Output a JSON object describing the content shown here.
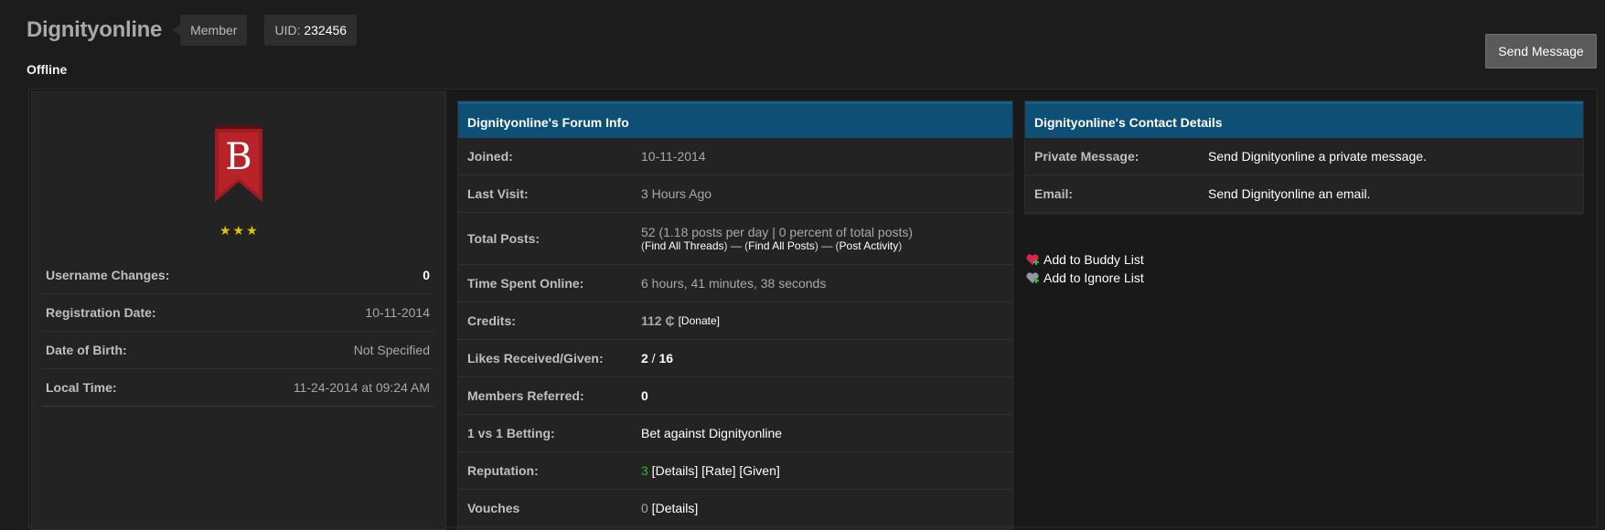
{
  "profile": {
    "username": "Dignityonline",
    "group": "Member",
    "uid_label": "UID:",
    "uid": "232456",
    "status": "Offline",
    "send_message_label": "Send Message",
    "avatar_letter": "B",
    "stars": "★★★"
  },
  "left_table": [
    {
      "label": "Username Changes:",
      "value": "0"
    },
    {
      "label": "Registration Date:",
      "value": "10-11-2014"
    },
    {
      "label": "Date of Birth:",
      "value": "Not Specified"
    },
    {
      "label": "Local Time:",
      "value": "11-24-2014 at 09:24 AM"
    }
  ],
  "forum_info": {
    "title": "Dignityonline's Forum Info",
    "joined": {
      "label": "Joined:",
      "value": "10-11-2014"
    },
    "last_visit": {
      "label": "Last Visit:",
      "value": "3 Hours Ago"
    },
    "total_posts": {
      "label": "Total Posts:",
      "value": "52 (1.18 posts per day | 0 percent of total posts)",
      "open_paren": "(",
      "find_threads": "Find All Threads",
      "sep1": ") — (",
      "find_posts": "Find All Posts",
      "sep2": ") — (",
      "post_activity": "Post Activity",
      "close_paren": ")"
    },
    "time_online": {
      "label": "Time Spent Online:",
      "value": "6 hours, 41 minutes, 38 seconds"
    },
    "credits": {
      "label": "Credits:",
      "value": "112 ₵",
      "donate": "[Donate]"
    },
    "likes": {
      "label": "Likes Received/Given:",
      "received": "2",
      "slash": " / ",
      "given": "16"
    },
    "referred": {
      "label": "Members Referred:",
      "value": "0"
    },
    "betting": {
      "label": "1 vs 1 Betting:",
      "value": "Bet against Dignityonline"
    },
    "reputation": {
      "label": "Reputation:",
      "value": "3",
      "open1": " [",
      "details": "Details",
      "mid1": "] [",
      "rate": "Rate",
      "mid2": "] [",
      "given": "Given",
      "close": "]"
    },
    "vouches": {
      "label": "Vouches",
      "value": "0",
      "open": " [",
      "details": "Details",
      "close": "]"
    }
  },
  "contact": {
    "title": "Dignityonline's Contact Details",
    "pm": {
      "label": "Private Message:",
      "value": "Send Dignityonline a private message."
    },
    "email": {
      "label": "Email:",
      "value": "Send Dignityonline an email."
    }
  },
  "lists": {
    "buddy": "Add to Buddy List",
    "ignore": "Add to Ignore List"
  },
  "colors": {
    "header_blue": "#0e4f76",
    "reputation_green": "#2db52d",
    "star_gold": "#e5c100",
    "avatar_red": "#a01b22"
  }
}
